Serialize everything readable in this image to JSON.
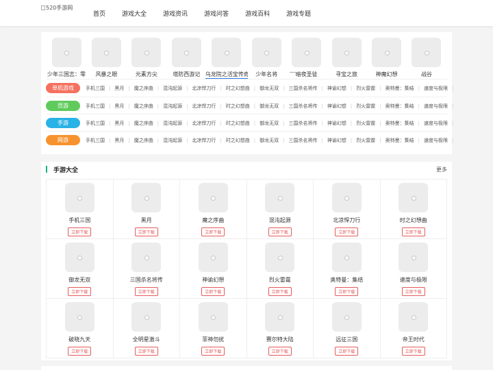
{
  "header": {
    "logo_alt": "520手游网",
    "nav": [
      "首页",
      "游戏大全",
      "游戏资讯",
      "游戏问答",
      "游戏百科",
      "游戏专题"
    ]
  },
  "top_games": [
    {
      "name": "少年三国志：零"
    },
    {
      "name": "风暴之眼"
    },
    {
      "name": "元素方尖"
    },
    {
      "name": "塔防西游记"
    },
    {
      "name": "乌龙院之活宝传奇"
    },
    {
      "name": "少年名将"
    },
    {
      "name": "暗夜圣徒"
    },
    {
      "name": "寻宝之旅"
    },
    {
      "name": "神魔幻想"
    },
    {
      "name": "战谷"
    }
  ],
  "categories": [
    {
      "label": "单机游戏",
      "color": "#f4715f",
      "links": [
        "手机三国",
        "黑月",
        "魔之序曲",
        "混沌起源",
        "北凉悍刀行",
        "时之幻想曲",
        "御龙无双",
        "三国杀名将传",
        "神谕幻想",
        "烈火雷霆",
        "奥特曼：集结",
        "速度与极限"
      ]
    },
    {
      "label": "页游",
      "color": "#5fcb5c",
      "links": [
        "手机三国",
        "黑月",
        "魔之序曲",
        "混沌起源",
        "北凉悍刀行",
        "时之幻想曲",
        "御龙无双",
        "三国杀名将传",
        "神谕幻想",
        "烈火雷霆",
        "奥特曼：集结",
        "速度与极限"
      ]
    },
    {
      "label": "手游",
      "color": "#29b2e6",
      "links": [
        "手机三国",
        "黑月",
        "魔之序曲",
        "混沌起源",
        "北凉悍刀行",
        "时之幻想曲",
        "御龙无双",
        "三国杀名将传",
        "神谕幻想",
        "烈火雷霆",
        "奥特曼：集结",
        "速度与极限"
      ]
    },
    {
      "label": "网游",
      "color": "#f7932f",
      "links": [
        "手机三国",
        "黑月",
        "魔之序曲",
        "混沌起源",
        "北凉悍刀行",
        "时之幻想曲",
        "御龙无双",
        "三国杀名将传",
        "神谕幻想",
        "烈火雷霆",
        "奥特曼：集结",
        "速度与极限"
      ]
    }
  ],
  "section": {
    "title": "手游大全",
    "more": "更多",
    "download_label": "立即下载",
    "games": [
      "手机三国",
      "黑月",
      "魔之序曲",
      "混沌起源",
      "北凉悍刀行",
      "时之幻想曲",
      "御龙无双",
      "三国杀名将传",
      "神谕幻想",
      "烈火雷霆",
      "奥特曼：集结",
      "速度与极限",
      "破晓九天",
      "全明星激斗",
      "菲神勿扰",
      "赛尔特大陆",
      "远征三国",
      "帝王时代"
    ]
  }
}
